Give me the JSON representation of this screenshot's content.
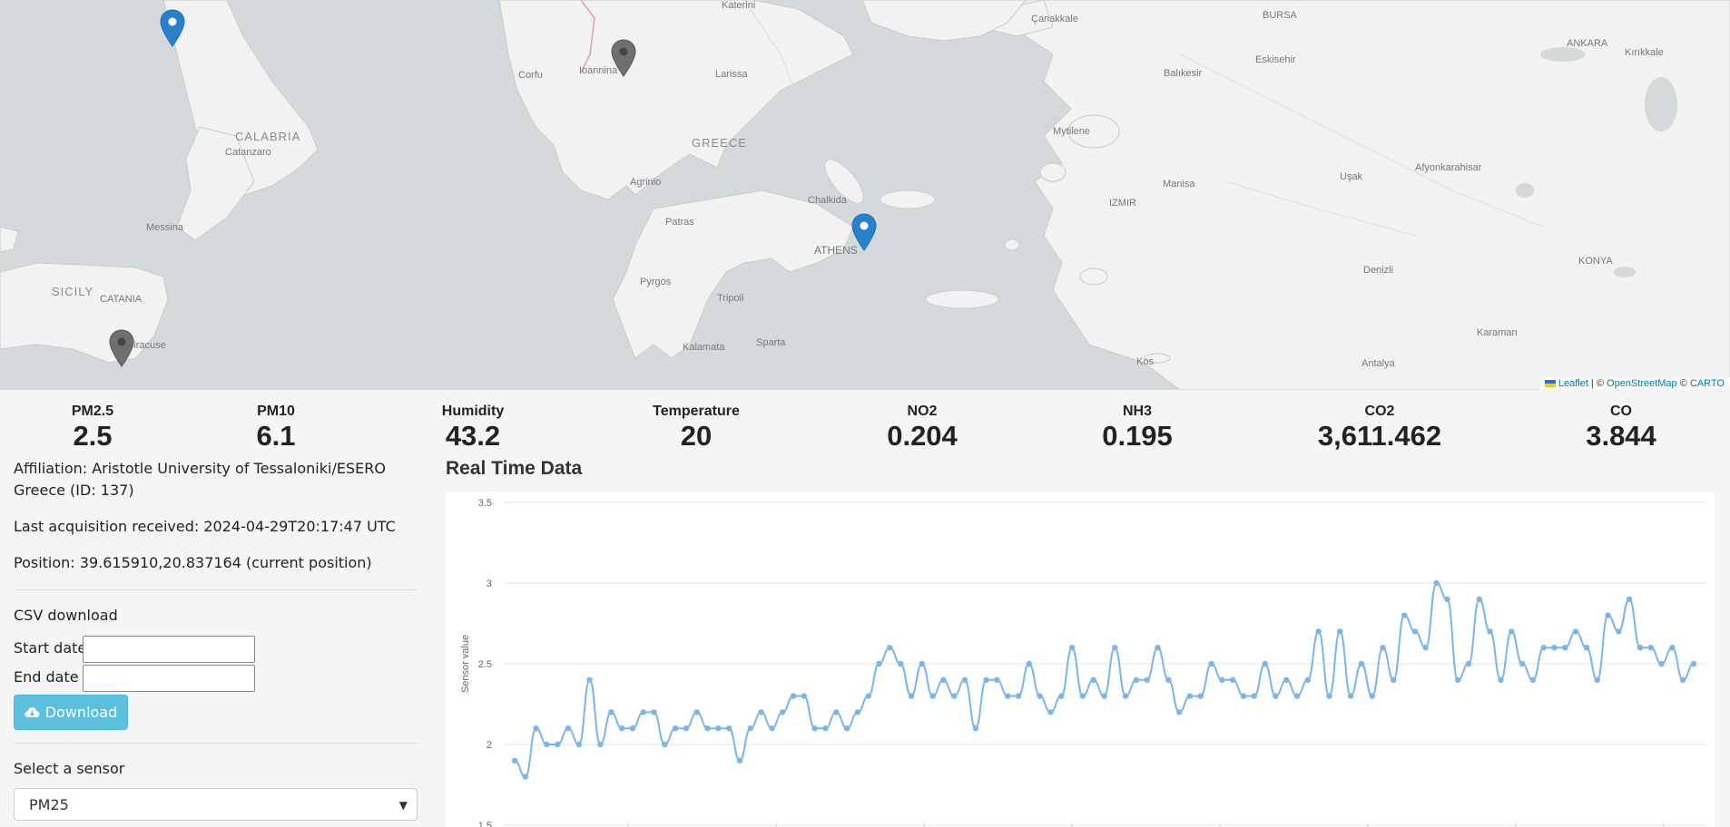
{
  "map": {
    "cities": [
      "Katerini",
      "Çanakkale",
      "BURSA",
      "Corfu",
      "Ioannina",
      "Larissa",
      "Eskisehir",
      "ANKARA",
      "Kırıkkale",
      "Catanzaro",
      "Balıkesir",
      "Mytilene",
      "Agrinio",
      "Chalkida",
      "Manisa",
      "Uşak",
      "Afyonkarahisar",
      "IZMIR",
      "Messina",
      "Patras",
      "ATHENS",
      "CATANIA",
      "Denizli",
      "KONYA",
      "Pyrgos",
      "Tripoli",
      "Kalamata",
      "Sparta",
      "Siracuse",
      "Karaman",
      "Kos",
      "Antalya"
    ],
    "regions": [
      "CALABRIA",
      "GREECE",
      "SICILY"
    ],
    "attribution": {
      "leaflet": "Leaflet",
      "sep1": " | © ",
      "osm": "OpenStreetMap",
      "sep2": " © ",
      "carto": "CARTO"
    },
    "markers": [
      {
        "color": "#2a81cb",
        "icon": "map-pin-icon"
      },
      {
        "color": "#6f6f6f",
        "icon": "map-pin-icon"
      },
      {
        "color": "#2a81cb",
        "icon": "map-pin-icon"
      },
      {
        "color": "#6f6f6f",
        "icon": "map-pin-icon"
      }
    ]
  },
  "metrics": [
    {
      "label": "PM2.5",
      "value": "2.5"
    },
    {
      "label": "PM10",
      "value": "6.1"
    },
    {
      "label": "Humidity",
      "value": "43.2"
    },
    {
      "label": "Temperature",
      "value": "20"
    },
    {
      "label": "NO2",
      "value": "0.204"
    },
    {
      "label": "NH3",
      "value": "0.195"
    },
    {
      "label": "CO2",
      "value": "3,611.462"
    },
    {
      "label": "CO",
      "value": "3.844"
    }
  ],
  "info": {
    "affiliation": "Affiliation: Aristotle University of Tessaloniki/ESERO Greece (ID: 137)",
    "last_acquisition": "Last acquisition received: 2024-04-29T20:17:47 UTC",
    "position": "Position: 39.615910,20.837164 (current position)"
  },
  "csv": {
    "heading": "CSV download",
    "start_label": "Start date",
    "end_label": "End date",
    "start_value": "",
    "end_value": "",
    "download_label": "Download",
    "download_icon": "cloud-download-icon"
  },
  "sensor": {
    "heading": "Select a sensor",
    "selected": "PM25"
  },
  "chart_title": "Real Time Data",
  "chart_data": {
    "type": "line",
    "title": "Real Time Data",
    "ylabel": "Sensor value",
    "xlabel": "",
    "ylim": [
      1.5,
      3.5
    ],
    "yticks": [
      "1.5",
      "2",
      "2.5",
      "3",
      "3.5"
    ],
    "grid": true,
    "color": "#7cb5ec",
    "series": [
      {
        "values": [
          1.9,
          1.8,
          2.1,
          2.0,
          2.0,
          2.1,
          2.0,
          2.4,
          2.0,
          2.2,
          2.1,
          2.1,
          2.2,
          2.2,
          2.0,
          2.1,
          2.1,
          2.2,
          2.1,
          2.1,
          2.1,
          1.9,
          2.1,
          2.2,
          2.1,
          2.2,
          2.3,
          2.3,
          2.1,
          2.1,
          2.2,
          2.1,
          2.2,
          2.3,
          2.5,
          2.6,
          2.5,
          2.3,
          2.5,
          2.3,
          2.4,
          2.3,
          2.4,
          2.1,
          2.4,
          2.4,
          2.3,
          2.3,
          2.5,
          2.3,
          2.2,
          2.3,
          2.6,
          2.3,
          2.4,
          2.3,
          2.6,
          2.3,
          2.4,
          2.4,
          2.6,
          2.4,
          2.2,
          2.3,
          2.3,
          2.5,
          2.4,
          2.4,
          2.3,
          2.3,
          2.5,
          2.3,
          2.4,
          2.3,
          2.4,
          2.7,
          2.3,
          2.7,
          2.3,
          2.5,
          2.3,
          2.6,
          2.4,
          2.8,
          2.7,
          2.6,
          3.0,
          2.9,
          2.4,
          2.5,
          2.9,
          2.7,
          2.4,
          2.7,
          2.5,
          2.4,
          2.6,
          2.6,
          2.6,
          2.7,
          2.6,
          2.4,
          2.8,
          2.7,
          2.9,
          2.6,
          2.6,
          2.5,
          2.6,
          2.4,
          2.5
        ]
      }
    ]
  }
}
